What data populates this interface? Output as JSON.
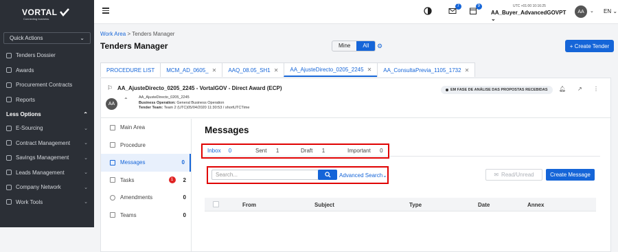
{
  "sidebar": {
    "brand": "VORTAL",
    "tagline": "Connecting business.",
    "quick_actions": "Quick Actions",
    "items": [
      {
        "label": "Tenders Dossier",
        "icon": "box-icon"
      },
      {
        "label": "Awards",
        "icon": "trophy-icon"
      },
      {
        "label": "Procurement Contracts",
        "icon": "pen-icon"
      },
      {
        "label": "Reports",
        "icon": "report-icon"
      }
    ],
    "section_label": "Less Options",
    "groups": [
      {
        "label": "E-Sourcing",
        "icon": "cart-icon"
      },
      {
        "label": "Contract Management",
        "icon": "contract-icon"
      },
      {
        "label": "Savings Management",
        "icon": "savings-icon"
      },
      {
        "label": "Leads Management",
        "icon": "leads-icon"
      },
      {
        "label": "Company Network",
        "icon": "network-icon"
      },
      {
        "label": "Work Tools",
        "icon": "tools-icon"
      }
    ]
  },
  "topbar": {
    "notifications_count": "7",
    "calendar_count": "9",
    "utc_time": "UTC +01:00 10:16:25",
    "user_name": "AA_Buyer_AdvancedGOVPT",
    "avatar": "AA",
    "language": "EN"
  },
  "breadcrumb": {
    "root": "Work Area",
    "separator": ">",
    "current": "Tenders Manager"
  },
  "page": {
    "title": "Tenders Manager",
    "toggle_mine": "Mine",
    "toggle_all": "All",
    "create_tender": "+ Create Tender"
  },
  "tabs": [
    {
      "label": "PROCEDURE LIST",
      "closable": false
    },
    {
      "label": "MCM_AD_0605_",
      "closable": true
    },
    {
      "label": "AAQ_08.05_SH1",
      "closable": true
    },
    {
      "label": "AA_AjusteDirecto_0205_2245",
      "closable": true,
      "active": true
    },
    {
      "label": "AA_ConsultaPrevia_1105_1732",
      "closable": true
    }
  ],
  "tender": {
    "title": "AA_AjusteDirecto_0205_2245 - VortalGOV - Direct Award (ECP)",
    "avatar": "AA",
    "ref": "AA_AjusteDirecto_0205_2245",
    "business_operation_label": "Business Operation:",
    "business_operation": "General Business Operation",
    "team_label": "Tender Team:",
    "team": "Team 2 (UTC)05/04/2020 11:30:53 / shortUTCTime",
    "status": "EM FASE DE ANÁLISE DAS PROPOSTAS RECEBIDAS"
  },
  "left_nav": [
    {
      "label": "Main Area",
      "count": ""
    },
    {
      "label": "Procedure",
      "count": ""
    },
    {
      "label": "Messages",
      "count": "0",
      "active": true
    },
    {
      "label": "Tasks",
      "count": "2",
      "alert": "1"
    },
    {
      "label": "Amendments",
      "count": "0"
    },
    {
      "label": "Teams",
      "count": "0"
    }
  ],
  "messages": {
    "title": "Messages",
    "tabs": [
      {
        "label": "Inbox",
        "count": "0"
      },
      {
        "label": "Sent",
        "count": "1"
      },
      {
        "label": "Draft",
        "count": "1"
      },
      {
        "label": "Important",
        "count": "0"
      }
    ],
    "search_placeholder": "Search...",
    "advanced_search": "Advanced Search",
    "read_unread": "Read/Unread",
    "create_message": "Create Message",
    "columns": [
      "From",
      "Subject",
      "Type",
      "Date",
      "Annex"
    ]
  },
  "colors": {
    "accent": "#1565d8",
    "sidebar_bg": "#2b2f36",
    "highlight_box": "#e00000",
    "alert": "#e02424"
  }
}
